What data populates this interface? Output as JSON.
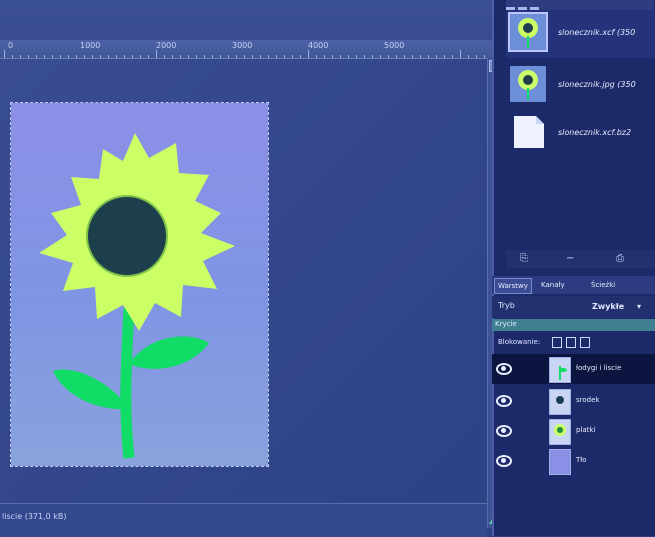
{
  "ruler": {
    "labels": [
      "0",
      "1000",
      "2000",
      "3000",
      "4000",
      "5000"
    ]
  },
  "status": {
    "text": "liscie (371,0 kB)"
  },
  "documents": [
    {
      "name": "slonecznik.xcf (350",
      "thumb": "sunflower"
    },
    {
      "name": "slonecznik.jpg (350",
      "thumb": "sunflower"
    },
    {
      "name": "slonecznik.xcf.bz2",
      "thumb": "blank-file"
    }
  ],
  "doc_toolbar": {
    "new_icon": "new-document-icon",
    "close_icon": "minus-icon",
    "print_icon": "printer-icon"
  },
  "layers_panel": {
    "tabs": [
      "Warstwy",
      "Kanały",
      "Ścieżki"
    ],
    "mode_label": "Tryb",
    "mode_value": "Zwykłe",
    "opacity_label": "Krycie",
    "lock_label": "Blokowanie:",
    "layers": [
      {
        "name": "łodygi i liscie",
        "visible": true,
        "selected": true
      },
      {
        "name": "srodek",
        "visible": true,
        "selected": false
      },
      {
        "name": "platki",
        "visible": true,
        "selected": false
      },
      {
        "name": "Tło",
        "visible": true,
        "selected": false
      }
    ]
  },
  "colors": {
    "petals": "#ccff66",
    "center": "#1f3e4c",
    "stem": "#11dd66",
    "background_layer": "#8c8fe6",
    "workspace": "#34478c",
    "panel": "#1d2a6a"
  }
}
